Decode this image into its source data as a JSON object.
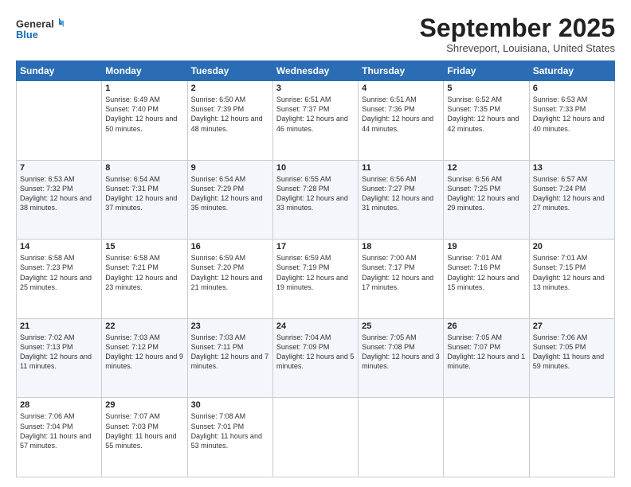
{
  "header": {
    "logo_line1": "General",
    "logo_line2": "Blue",
    "month_title": "September 2025",
    "location": "Shreveport, Louisiana, United States"
  },
  "days_of_week": [
    "Sunday",
    "Monday",
    "Tuesday",
    "Wednesday",
    "Thursday",
    "Friday",
    "Saturday"
  ],
  "weeks": [
    [
      {
        "day": "",
        "sunrise": "",
        "sunset": "",
        "daylight": ""
      },
      {
        "day": "1",
        "sunrise": "Sunrise: 6:49 AM",
        "sunset": "Sunset: 7:40 PM",
        "daylight": "Daylight: 12 hours and 50 minutes."
      },
      {
        "day": "2",
        "sunrise": "Sunrise: 6:50 AM",
        "sunset": "Sunset: 7:39 PM",
        "daylight": "Daylight: 12 hours and 48 minutes."
      },
      {
        "day": "3",
        "sunrise": "Sunrise: 6:51 AM",
        "sunset": "Sunset: 7:37 PM",
        "daylight": "Daylight: 12 hours and 46 minutes."
      },
      {
        "day": "4",
        "sunrise": "Sunrise: 6:51 AM",
        "sunset": "Sunset: 7:36 PM",
        "daylight": "Daylight: 12 hours and 44 minutes."
      },
      {
        "day": "5",
        "sunrise": "Sunrise: 6:52 AM",
        "sunset": "Sunset: 7:35 PM",
        "daylight": "Daylight: 12 hours and 42 minutes."
      },
      {
        "day": "6",
        "sunrise": "Sunrise: 6:53 AM",
        "sunset": "Sunset: 7:33 PM",
        "daylight": "Daylight: 12 hours and 40 minutes."
      }
    ],
    [
      {
        "day": "7",
        "sunrise": "Sunrise: 6:53 AM",
        "sunset": "Sunset: 7:32 PM",
        "daylight": "Daylight: 12 hours and 38 minutes."
      },
      {
        "day": "8",
        "sunrise": "Sunrise: 6:54 AM",
        "sunset": "Sunset: 7:31 PM",
        "daylight": "Daylight: 12 hours and 37 minutes."
      },
      {
        "day": "9",
        "sunrise": "Sunrise: 6:54 AM",
        "sunset": "Sunset: 7:29 PM",
        "daylight": "Daylight: 12 hours and 35 minutes."
      },
      {
        "day": "10",
        "sunrise": "Sunrise: 6:55 AM",
        "sunset": "Sunset: 7:28 PM",
        "daylight": "Daylight: 12 hours and 33 minutes."
      },
      {
        "day": "11",
        "sunrise": "Sunrise: 6:56 AM",
        "sunset": "Sunset: 7:27 PM",
        "daylight": "Daylight: 12 hours and 31 minutes."
      },
      {
        "day": "12",
        "sunrise": "Sunrise: 6:56 AM",
        "sunset": "Sunset: 7:25 PM",
        "daylight": "Daylight: 12 hours and 29 minutes."
      },
      {
        "day": "13",
        "sunrise": "Sunrise: 6:57 AM",
        "sunset": "Sunset: 7:24 PM",
        "daylight": "Daylight: 12 hours and 27 minutes."
      }
    ],
    [
      {
        "day": "14",
        "sunrise": "Sunrise: 6:58 AM",
        "sunset": "Sunset: 7:23 PM",
        "daylight": "Daylight: 12 hours and 25 minutes."
      },
      {
        "day": "15",
        "sunrise": "Sunrise: 6:58 AM",
        "sunset": "Sunset: 7:21 PM",
        "daylight": "Daylight: 12 hours and 23 minutes."
      },
      {
        "day": "16",
        "sunrise": "Sunrise: 6:59 AM",
        "sunset": "Sunset: 7:20 PM",
        "daylight": "Daylight: 12 hours and 21 minutes."
      },
      {
        "day": "17",
        "sunrise": "Sunrise: 6:59 AM",
        "sunset": "Sunset: 7:19 PM",
        "daylight": "Daylight: 12 hours and 19 minutes."
      },
      {
        "day": "18",
        "sunrise": "Sunrise: 7:00 AM",
        "sunset": "Sunset: 7:17 PM",
        "daylight": "Daylight: 12 hours and 17 minutes."
      },
      {
        "day": "19",
        "sunrise": "Sunrise: 7:01 AM",
        "sunset": "Sunset: 7:16 PM",
        "daylight": "Daylight: 12 hours and 15 minutes."
      },
      {
        "day": "20",
        "sunrise": "Sunrise: 7:01 AM",
        "sunset": "Sunset: 7:15 PM",
        "daylight": "Daylight: 12 hours and 13 minutes."
      }
    ],
    [
      {
        "day": "21",
        "sunrise": "Sunrise: 7:02 AM",
        "sunset": "Sunset: 7:13 PM",
        "daylight": "Daylight: 12 hours and 11 minutes."
      },
      {
        "day": "22",
        "sunrise": "Sunrise: 7:03 AM",
        "sunset": "Sunset: 7:12 PM",
        "daylight": "Daylight: 12 hours and 9 minutes."
      },
      {
        "day": "23",
        "sunrise": "Sunrise: 7:03 AM",
        "sunset": "Sunset: 7:11 PM",
        "daylight": "Daylight: 12 hours and 7 minutes."
      },
      {
        "day": "24",
        "sunrise": "Sunrise: 7:04 AM",
        "sunset": "Sunset: 7:09 PM",
        "daylight": "Daylight: 12 hours and 5 minutes."
      },
      {
        "day": "25",
        "sunrise": "Sunrise: 7:05 AM",
        "sunset": "Sunset: 7:08 PM",
        "daylight": "Daylight: 12 hours and 3 minutes."
      },
      {
        "day": "26",
        "sunrise": "Sunrise: 7:05 AM",
        "sunset": "Sunset: 7:07 PM",
        "daylight": "Daylight: 12 hours and 1 minute."
      },
      {
        "day": "27",
        "sunrise": "Sunrise: 7:06 AM",
        "sunset": "Sunset: 7:05 PM",
        "daylight": "Daylight: 11 hours and 59 minutes."
      }
    ],
    [
      {
        "day": "28",
        "sunrise": "Sunrise: 7:06 AM",
        "sunset": "Sunset: 7:04 PM",
        "daylight": "Daylight: 11 hours and 57 minutes."
      },
      {
        "day": "29",
        "sunrise": "Sunrise: 7:07 AM",
        "sunset": "Sunset: 7:03 PM",
        "daylight": "Daylight: 11 hours and 55 minutes."
      },
      {
        "day": "30",
        "sunrise": "Sunrise: 7:08 AM",
        "sunset": "Sunset: 7:01 PM",
        "daylight": "Daylight: 11 hours and 53 minutes."
      },
      {
        "day": "",
        "sunrise": "",
        "sunset": "",
        "daylight": ""
      },
      {
        "day": "",
        "sunrise": "",
        "sunset": "",
        "daylight": ""
      },
      {
        "day": "",
        "sunrise": "",
        "sunset": "",
        "daylight": ""
      },
      {
        "day": "",
        "sunrise": "",
        "sunset": "",
        "daylight": ""
      }
    ]
  ]
}
